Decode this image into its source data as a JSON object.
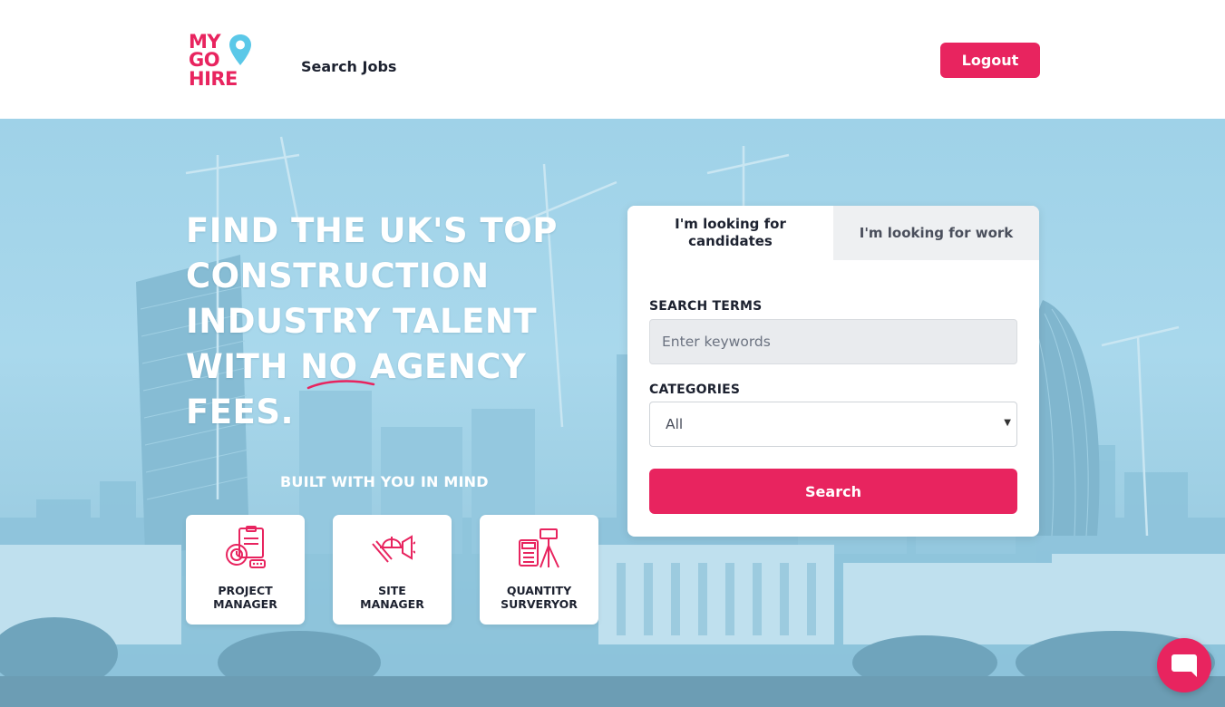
{
  "header": {
    "logo": {
      "line1": "MY",
      "line2": "GO",
      "line3": "HIRE"
    },
    "nav_search_label": "Search Jobs",
    "logout_label": "Logout"
  },
  "hero": {
    "headline_lines": [
      "FIND THE UK'S TOP",
      "CONSTRUCTION",
      "INDUSTRY TALENT",
      "WITH NO AGENCY",
      "FEES."
    ],
    "built_label": "BUILT WITH YOU IN MIND",
    "roles": [
      {
        "line1": "PROJECT",
        "line2": "MANAGER",
        "icon": "project-manager-icon"
      },
      {
        "line1": "SITE",
        "line2": "MANAGER",
        "icon": "site-manager-icon"
      },
      {
        "line1": "QUANTITY",
        "line2": "SURVERYOR",
        "icon": "quantity-surveyor-icon"
      }
    ]
  },
  "search_panel": {
    "tabs": [
      {
        "label": "I'm looking for candidates",
        "active": true
      },
      {
        "label": "I'm looking for work",
        "active": false
      }
    ],
    "search_terms_label": "SEARCH TERMS",
    "search_terms_placeholder": "Enter keywords",
    "search_terms_value": "",
    "categories_label": "CATEGORIES",
    "categories_selected": "All",
    "search_button_label": "Search"
  },
  "colors": {
    "brand_pink": "#e8245f",
    "brand_blue": "#5bc8e8",
    "hero_tint": "#9fd2e8"
  },
  "chat_button_icon": "chat-bubble-icon"
}
